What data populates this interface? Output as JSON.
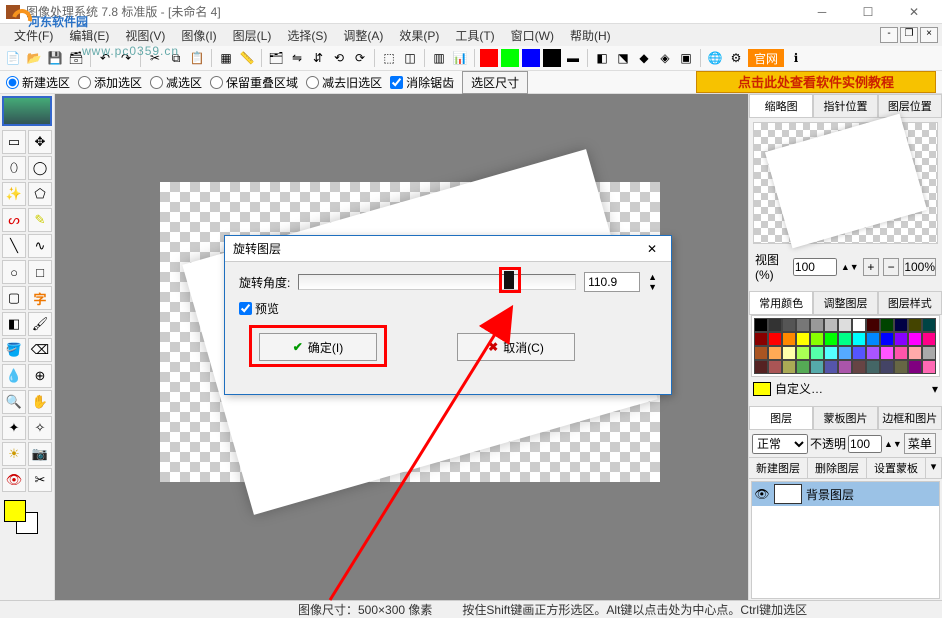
{
  "window": {
    "title": "图像处理系统 7.8 标准版 - [未命名 4]"
  },
  "watermark": {
    "text": "河东软件园",
    "url": "www.pc0359.cn"
  },
  "menu": [
    "文件(F)",
    "编辑(E)",
    "视图(V)",
    "图像(I)",
    "图层(L)",
    "选择(S)",
    "调整(A)",
    "效果(P)",
    "工具(T)",
    "窗口(W)",
    "帮助(H)"
  ],
  "options": {
    "new_sel": "新建选区",
    "add_sel": "添加选区",
    "sub_sel": "减选区",
    "keep_overlap": "保留重叠区域",
    "sub_old": "减去旧选区",
    "antialias": "消除锯齿",
    "size_btn": "选区尺寸"
  },
  "ad_banner": "点击此处查看软件实例教程",
  "right": {
    "tabs_top": [
      "缩略图",
      "指针位置",
      "图层位置"
    ],
    "zoom_label": "视图(%)",
    "zoom_value": "100",
    "btn_100": "100%",
    "tabs_pal": [
      "常用颜色",
      "调整图层",
      "图层样式"
    ],
    "custom_label": "自定义…",
    "tabs_layer": [
      "图层",
      "蒙板图片",
      "边框和图片"
    ],
    "blend": "正常",
    "opacity_label": "不透明",
    "opacity_value": "100",
    "menu_btn": "菜单",
    "layer_btns": [
      "新建图层",
      "删除图层",
      "设置蒙板"
    ],
    "layer_bg": "背景图层"
  },
  "dialog": {
    "title": "旋转图层",
    "angle_label": "旋转角度:",
    "angle_value": "110.9",
    "preview": "预览",
    "ok": "确定(I)",
    "cancel": "取消(C)"
  },
  "status": {
    "size": "图像尺寸：500×300 像素",
    "hint": "按住Shift键画正方形选区。Alt键以点击处为中心点。Ctrl键加选区"
  },
  "palette_colors": [
    "#000",
    "#333",
    "#555",
    "#777",
    "#999",
    "#bbb",
    "#ddd",
    "#fff",
    "#400",
    "#040",
    "#004",
    "#440",
    "#044",
    "#800",
    "#f00",
    "#f80",
    "#ff0",
    "#8f0",
    "#0f0",
    "#0f8",
    "#0ff",
    "#08f",
    "#00f",
    "#80f",
    "#f0f",
    "#f08",
    "#a52",
    "#fa5",
    "#ffa",
    "#af5",
    "#5fa",
    "#5ff",
    "#5af",
    "#55f",
    "#a5f",
    "#f5f",
    "#f5a",
    "#faa",
    "#aaa",
    "#522",
    "#a55",
    "#aa5",
    "#5a5",
    "#5aa",
    "#55a",
    "#a5a",
    "#644",
    "#466",
    "#446",
    "#664",
    "#800080",
    "#ff69b4"
  ]
}
